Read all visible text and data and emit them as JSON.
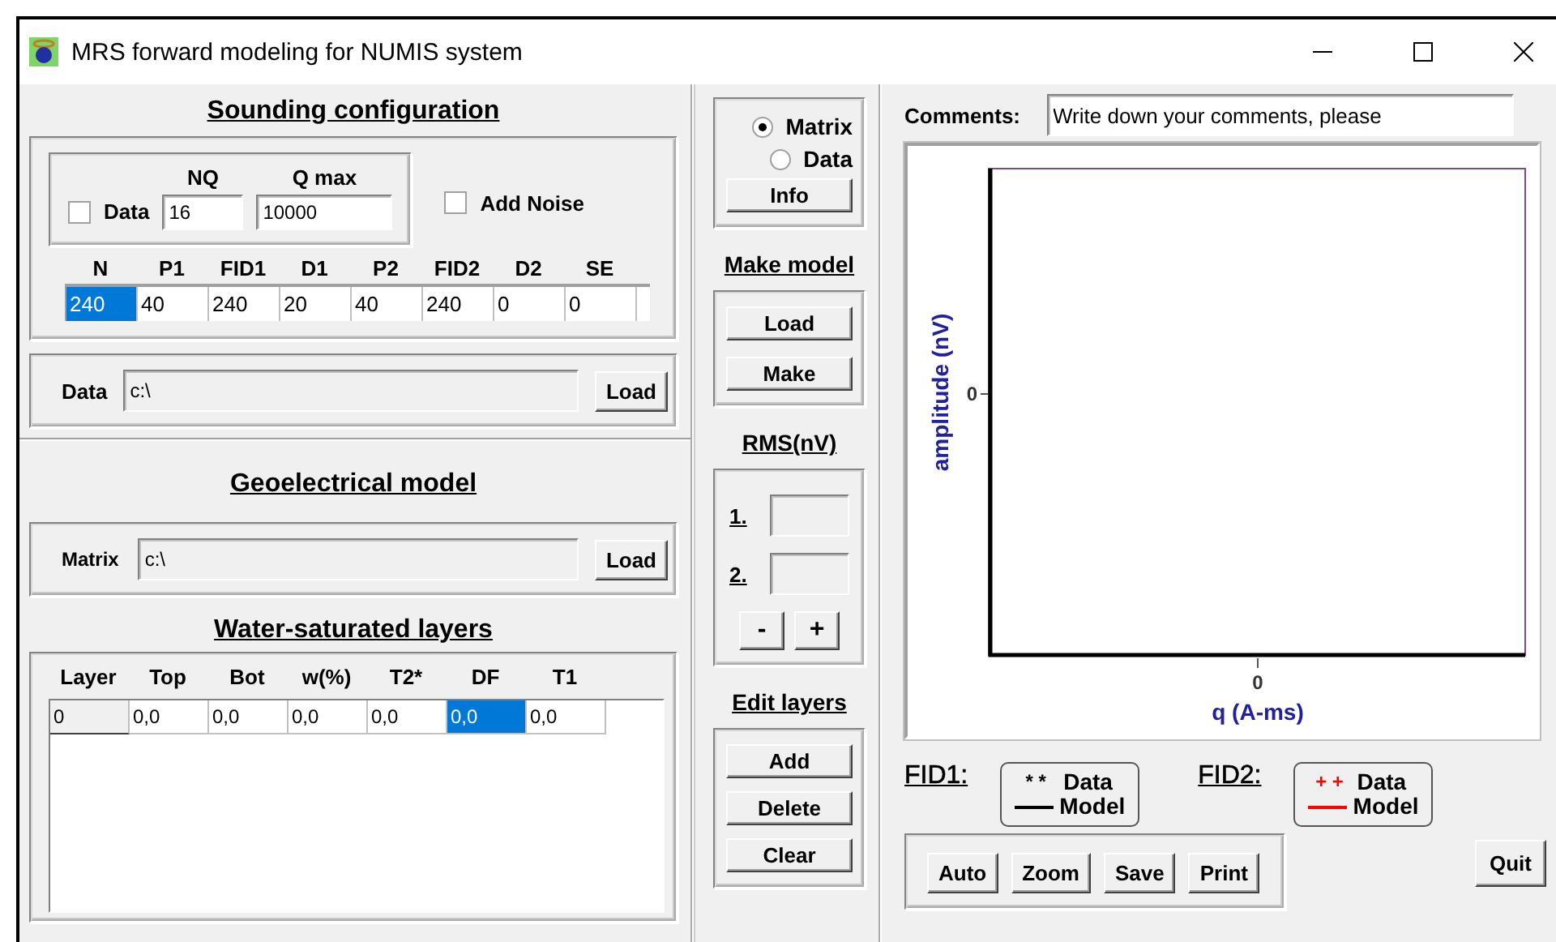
{
  "window": {
    "title": "MRS forward modeling  for NUMIS system"
  },
  "sounding": {
    "title": "Sounding configuration",
    "data_checkbox": {
      "label": "Data",
      "checked": false
    },
    "nq": {
      "label": "NQ",
      "value": "16"
    },
    "qmax": {
      "label": "Q max",
      "value": "10000"
    },
    "add_noise": {
      "label": "Add Noise",
      "checked": false
    },
    "grid": {
      "columns": [
        "N",
        "P1",
        "FID1",
        "D1",
        "P2",
        "FID2",
        "D2",
        "SE"
      ],
      "cells": [
        {
          "value": "240",
          "selected": true
        },
        {
          "value": "40",
          "selected": false
        },
        {
          "value": "240",
          "selected": false
        },
        {
          "value": "20",
          "selected": false
        },
        {
          "value": "40",
          "selected": false
        },
        {
          "value": "240",
          "selected": false
        },
        {
          "value": "0",
          "selected": false
        },
        {
          "value": "0",
          "selected": false
        }
      ]
    },
    "data_path": {
      "label": "Data",
      "value": "c:\\"
    },
    "load_button": "Load"
  },
  "geoelectrical": {
    "title": "Geoelectrical model ",
    "matrix": {
      "label": "Matrix",
      "value": "c:\\"
    },
    "load_button": "Load"
  },
  "layers": {
    "title": "Water-saturated layers",
    "columns": [
      "Layer",
      "Top",
      "Bot",
      "w(%)",
      "T2*",
      "DF",
      "T1"
    ],
    "rows": [
      {
        "cells": [
          {
            "value": "0",
            "selected": false
          },
          {
            "value": "0,0",
            "selected": false
          },
          {
            "value": "0,0",
            "selected": false
          },
          {
            "value": "0,0",
            "selected": false
          },
          {
            "value": "0,0",
            "selected": false
          },
          {
            "value": "0,0",
            "selected": true
          },
          {
            "value": "0,0",
            "selected": false
          }
        ]
      }
    ]
  },
  "source": {
    "options": [
      {
        "label": "Matrix",
        "selected": true
      },
      {
        "label": "Data",
        "selected": false
      }
    ],
    "info_button": "Info"
  },
  "make_model": {
    "title": "Make model",
    "buttons": [
      "Load",
      "Make"
    ]
  },
  "rms": {
    "title": "RMS(nV)",
    "fields": [
      {
        "label": "1."
      },
      {
        "label": "2."
      }
    ],
    "buttons": [
      "-",
      "+"
    ]
  },
  "edit_layers": {
    "title": "Edit layers",
    "buttons": [
      "Add",
      "Delete",
      "Clear"
    ]
  },
  "comments": {
    "label": "Comments:",
    "value": "Write down your comments, please"
  },
  "plot": {
    "ylabel": "amplitude (nV)",
    "ytick": "0",
    "xtick": "0",
    "xlabel": "q (A-ms)"
  },
  "legends": [
    {
      "label": "FID1:",
      "marker": "* *",
      "data": "Data",
      "model": "Model",
      "color": "#000000"
    },
    {
      "label": "FID2:",
      "marker": "+ +",
      "data": "Data",
      "model": "Model",
      "color": "#ff0000"
    }
  ],
  "plot_buttons": [
    "Auto",
    "Zoom",
    "Save",
    "Print"
  ],
  "quit_button": "Quit"
}
